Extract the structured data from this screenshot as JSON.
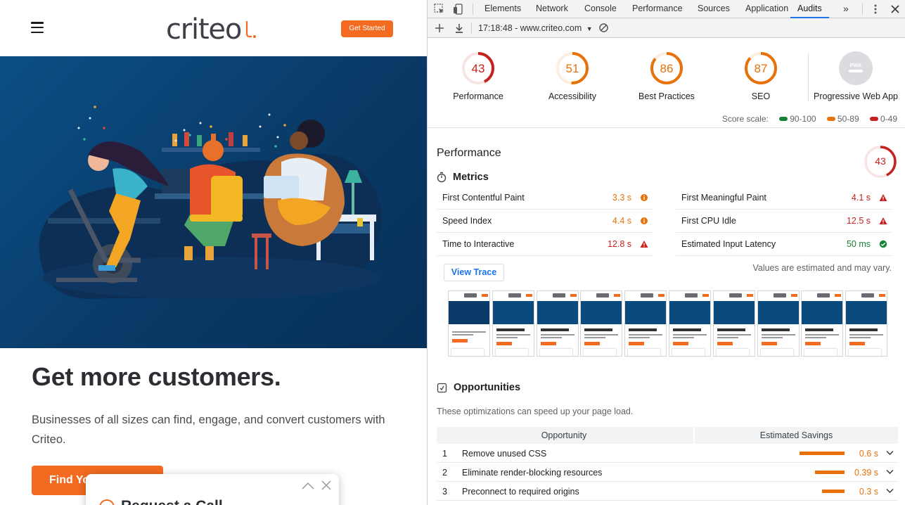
{
  "site": {
    "logo": "criteo",
    "get_started": "Get Started",
    "headline": "Get more customers.",
    "subtext": "Businesses of all sizes can find, engage, and convert customers with Criteo.",
    "find_button": "Find Yo",
    "request_card_title": "Request a Call",
    "brand_color": "#f26b21",
    "hero_color": "#0b4f86"
  },
  "devtools": {
    "tabs": [
      "Elements",
      "Network",
      "Console",
      "Performance",
      "Sources",
      "Application",
      "Audits"
    ],
    "active_tab": "Audits",
    "more_tabs": "»",
    "report": "17:18:48 - www.criteo.com",
    "gauges": [
      {
        "label": "Performance",
        "score": "43",
        "color": "#c5221f",
        "fraction": 0.43
      },
      {
        "label": "Accessibility",
        "score": "51",
        "color": "#e8710a",
        "fraction": 0.51
      },
      {
        "label": "Best Practices",
        "score": "86",
        "color": "#e8710a",
        "fraction": 0.86
      },
      {
        "label": "SEO",
        "score": "87",
        "color": "#e8710a",
        "fraction": 0.87
      }
    ],
    "pwa": {
      "label": "Progressive Web App",
      "badge": "PWA"
    },
    "score_scale": {
      "label": "Score scale:",
      "ranges": [
        {
          "text": "90-100",
          "color": "#188038"
        },
        {
          "text": "50-89",
          "color": "#e8710a"
        },
        {
          "text": "0-49",
          "color": "#c5221f"
        }
      ]
    },
    "performance": {
      "title": "Performance",
      "score": "43",
      "metrics_title": "Metrics",
      "metrics": [
        {
          "name": "First Contentful Paint",
          "value": "3.3 s",
          "status": "average"
        },
        {
          "name": "First Meaningful Paint",
          "value": "4.1 s",
          "status": "fail"
        },
        {
          "name": "Speed Index",
          "value": "4.4 s",
          "status": "average"
        },
        {
          "name": "First CPU Idle",
          "value": "12.5 s",
          "status": "fail"
        },
        {
          "name": "Time to Interactive",
          "value": "12.8 s",
          "status": "fail"
        },
        {
          "name": "Estimated Input Latency",
          "value": "50 ms",
          "status": "pass"
        }
      ],
      "view_trace": "View Trace",
      "estimated_note": "Values are estimated and may vary.",
      "filmstrip_frames": 10
    },
    "opportunities": {
      "title": "Opportunities",
      "description": "These optimizations can speed up your page load.",
      "col_opportunity": "Opportunity",
      "col_savings": "Estimated Savings",
      "rows": [
        {
          "num": "1",
          "name": "Remove unused CSS",
          "savings": "0.6 s",
          "bar_fraction": 0.6
        },
        {
          "num": "2",
          "name": "Eliminate render-blocking resources",
          "savings": "0.39 s",
          "bar_fraction": 0.39
        },
        {
          "num": "3",
          "name": "Preconnect to required origins",
          "savings": "0.3 s",
          "bar_fraction": 0.3
        }
      ]
    },
    "status_colors": {
      "pass": "#188038",
      "average": "#e8710a",
      "fail": "#c5221f"
    }
  }
}
